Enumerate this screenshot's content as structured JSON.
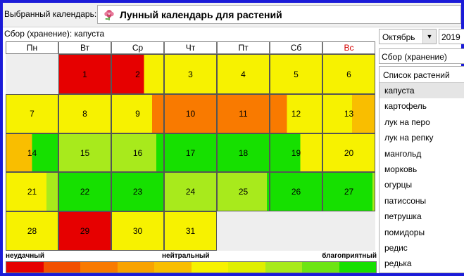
{
  "topbar": {
    "label": "Выбранный календарь:",
    "calendar_title": "Лунный календарь для растений",
    "calendar_icon": "flower-icon"
  },
  "subtitle": "Сбор (хранение): капуста",
  "controls": {
    "month": "Октябрь",
    "year": "2019",
    "mode": "Сбор (хранение)"
  },
  "plants": {
    "header": "Список растений",
    "items": [
      "капуста",
      "картофель",
      "лук на перо",
      "лук на репку",
      "мангольд",
      "морковь",
      "огурцы",
      "патиссоны",
      "петрушка",
      "помидоры",
      "редис",
      "редька"
    ],
    "selected_index": 0
  },
  "weekdays": [
    "Пн",
    "Вт",
    "Ср",
    "Чт",
    "Пт",
    "Сб",
    "Вс"
  ],
  "weekend_color": "#d40000",
  "calendar": {
    "first_weekday_offset": 1,
    "days": [
      {
        "day": "1",
        "fill": "#e60000",
        "right": null
      },
      {
        "day": "2",
        "fill": "#e60000",
        "right": "#f7f200",
        "split": 0.62
      },
      {
        "day": "3",
        "fill": "#f7f200",
        "right": null
      },
      {
        "day": "4",
        "fill": "#f7f200",
        "right": null
      },
      {
        "day": "5",
        "fill": "#f7f200",
        "right": null
      },
      {
        "day": "6",
        "fill": "#f7f200",
        "right": null
      },
      {
        "day": "7",
        "fill": "#f7f200",
        "right": null
      },
      {
        "day": "8",
        "fill": "#f7f200",
        "right": null
      },
      {
        "day": "9",
        "fill": "#f7f200",
        "right": "#f97a00",
        "split": 0.78
      },
      {
        "day": "10",
        "fill": "#f97a00",
        "right": null
      },
      {
        "day": "11",
        "fill": "#f97a00",
        "right": null
      },
      {
        "day": "12",
        "fill": "#f97a00",
        "left_fill": "#f97a00",
        "right": "#f7f200",
        "split": 0.32
      },
      {
        "day": "13",
        "fill": "#f7f200",
        "right": "#f9be00",
        "split": 0.56
      },
      {
        "day": "14",
        "fill": "#f9be00",
        "right": "#16e000",
        "split": 0.5
      },
      {
        "day": "15",
        "fill": "#a8ea1c",
        "right": null
      },
      {
        "day": "16",
        "fill": "#a8ea1c",
        "right": "#16e000",
        "split": 0.86
      },
      {
        "day": "17",
        "fill": "#16e000",
        "right": null
      },
      {
        "day": "18",
        "fill": "#16e000",
        "right": null
      },
      {
        "day": "19",
        "fill": "#16e000",
        "right": "#f7f200",
        "split": 0.58
      },
      {
        "day": "20",
        "fill": "#f7f200",
        "right": null
      },
      {
        "day": "21",
        "fill": "#f7f200",
        "right": "#a8ea1c",
        "split": 0.78
      },
      {
        "day": "22",
        "fill": "#16e000",
        "right": null
      },
      {
        "day": "23",
        "fill": "#16e000",
        "right": null
      },
      {
        "day": "24",
        "fill": "#a8ea1c",
        "right": null
      },
      {
        "day": "25",
        "fill": "#a8ea1c",
        "right": "#16e000",
        "split": 0.96
      },
      {
        "day": "26",
        "fill": "#16e000",
        "right": null
      },
      {
        "day": "27",
        "fill": "#16e000",
        "right": "#a8ea1c",
        "split": 0.96
      },
      {
        "day": "28",
        "fill": "#f7f200",
        "right": null
      },
      {
        "day": "29",
        "fill": "#e60000",
        "right": null
      },
      {
        "day": "30",
        "fill": "#f7f200",
        "right": null
      },
      {
        "day": "31",
        "fill": "#f7f200",
        "right": null
      }
    ]
  },
  "legend": {
    "bad_label": "неудачный",
    "neutral_label": "нейтральный",
    "good_label": "благоприятный",
    "colors": [
      "#e60000",
      "#f25000",
      "#f97a00",
      "#f9a300",
      "#f9be00",
      "#f7f200",
      "#e0ef00",
      "#a8ea1c",
      "#6de514",
      "#16e000"
    ]
  }
}
